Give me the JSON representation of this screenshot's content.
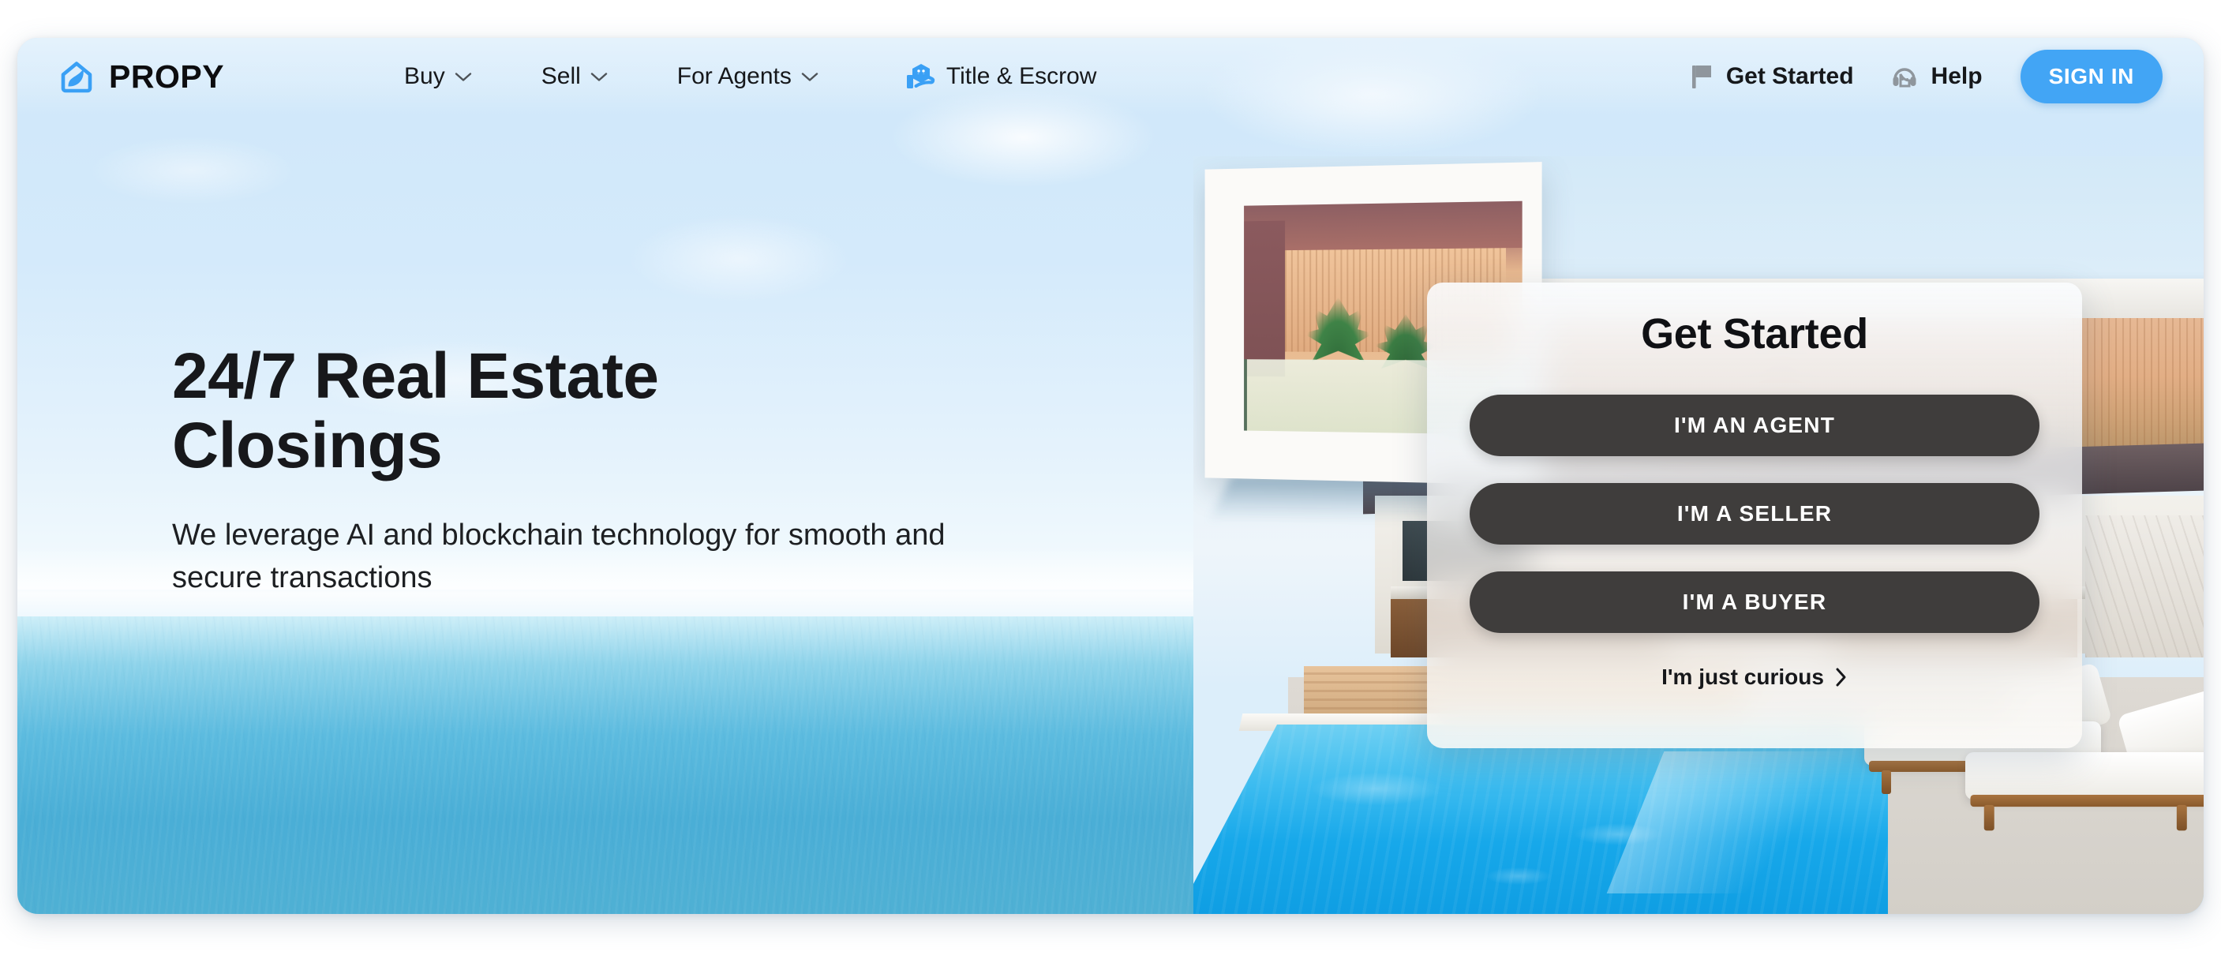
{
  "brand": {
    "name": "PROPY",
    "logo_icon": "house-leaf-logo-icon",
    "accent_color": "#42A5F5"
  },
  "nav": {
    "links": [
      {
        "label": "Buy",
        "has_dropdown": true,
        "icon": null
      },
      {
        "label": "Sell",
        "has_dropdown": true,
        "icon": null
      },
      {
        "label": "For Agents",
        "has_dropdown": true,
        "icon": null
      },
      {
        "label": "Title & Escrow",
        "has_dropdown": false,
        "icon": "house-in-hand-icon"
      }
    ],
    "actions": [
      {
        "label": "Get Started",
        "icon": "flag-icon"
      },
      {
        "label": "Help",
        "icon": "headset-support-icon"
      }
    ],
    "sign_in_label": "SIGN IN"
  },
  "hero": {
    "title_line_1": "24/7 Real Estate",
    "title_line_2": "Closings",
    "subtitle": "We leverage AI and blockchain technology for smooth and secure transactions"
  },
  "get_started_modal": {
    "title": "Get Started",
    "buttons": [
      {
        "label": "I'M AN AGENT"
      },
      {
        "label": "I'M A SELLER"
      },
      {
        "label": "I'M A BUYER"
      }
    ],
    "secondary_link": {
      "label": "I'm just curious",
      "icon": "chevron-right-icon"
    },
    "panel_color": "#F2F4F6",
    "button_color": "#3F3D3C"
  }
}
